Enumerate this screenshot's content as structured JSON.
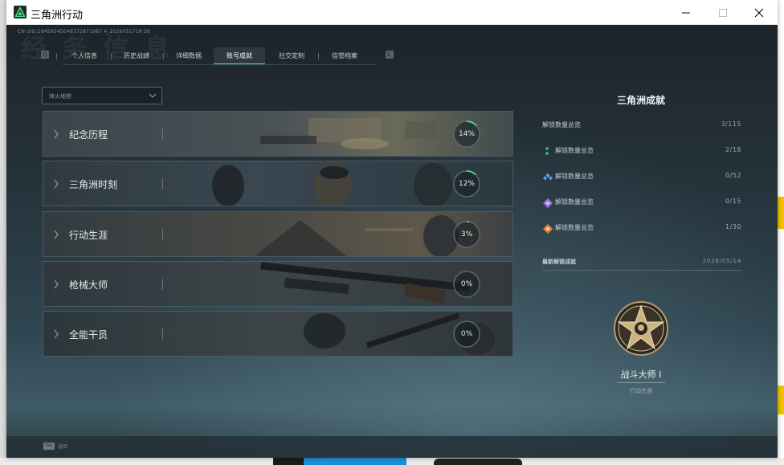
{
  "window": {
    "title": "三角洲行动",
    "minimize_icon": "minimize-icon",
    "maximize_icon": "maximize-icon",
    "close_icon": "close-icon"
  },
  "header": {
    "uid_text": "CN UID:18459545048372871987 4_2026051718 38",
    "ghost_title": "经 务 信 息"
  },
  "tabs": [
    {
      "label": "个人信息",
      "active": false
    },
    {
      "label": "历史战绩",
      "active": false
    },
    {
      "label": "详细数据",
      "active": false
    },
    {
      "label": "账号成就",
      "active": true
    },
    {
      "label": "社交定制",
      "active": false
    },
    {
      "label": "信誉档案",
      "active": false
    }
  ],
  "filter": {
    "value": "烽火地带"
  },
  "categories": [
    {
      "name": "纪念历程",
      "progress_label": "14%",
      "progress": 0.14
    },
    {
      "name": "三角洲时刻",
      "progress_label": "12%",
      "progress": 0.12
    },
    {
      "name": "行动生涯",
      "progress_label": "3%",
      "progress": 0.03
    },
    {
      "name": "枪械大师",
      "progress_label": "0%",
      "progress": 0.0
    },
    {
      "name": "全能干员",
      "progress_label": "0%",
      "progress": 0.0
    }
  ],
  "category_faint": "· · ·",
  "panel": {
    "title": "三角洲成就",
    "total": {
      "label": "解锁数量总览",
      "value": "3/115"
    },
    "tiers": [
      {
        "label": "解锁数量总览",
        "value": "2/18",
        "icon": "green-tier-icon",
        "color": "#3fcf8e"
      },
      {
        "label": "解锁数量总览",
        "value": "0/52",
        "icon": "blue-tier-icon",
        "color": "#4fa3e8"
      },
      {
        "label": "解锁数量总览",
        "value": "0/15",
        "icon": "purple-tier-icon",
        "color": "#a070e8"
      },
      {
        "label": "解锁数量总览",
        "value": "1/30",
        "icon": "orange-tier-icon",
        "color": "#e8853a"
      }
    ],
    "recent": {
      "label": "最新解锁成就",
      "date": "2026/05/14"
    },
    "medal": {
      "name": "战斗大师 I",
      "category": "行动生涯",
      "icon": "star-medal-icon"
    }
  },
  "footer": {
    "badge": "Esc",
    "text": "返回"
  },
  "colors": {
    "accent": "#4be08a",
    "ring_track": "#5b676c"
  }
}
